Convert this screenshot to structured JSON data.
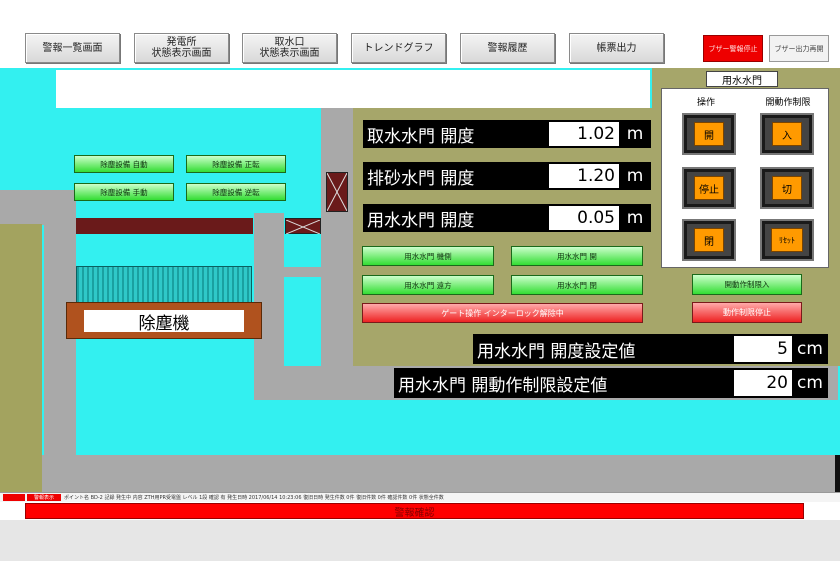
{
  "nav": [
    {
      "label": "警報一覧画面"
    },
    {
      "label": "発電所\n状態表示画面"
    },
    {
      "label": "取水口\n状態表示画面"
    },
    {
      "label": "トレンドグラフ"
    },
    {
      "label": "警報履歴"
    },
    {
      "label": "帳票出力"
    }
  ],
  "small_buttons": {
    "red": "ブザー警報停止",
    "gray": "ブザー出力再開"
  },
  "dust_remover": {
    "buttons": [
      "除塵設備 自動",
      "除塵設備 正転",
      "除塵設備 手動",
      "除塵設備 逆転"
    ],
    "label": "除塵機"
  },
  "gate_readings": [
    {
      "label": "取水水門 開度",
      "value": "1.02",
      "unit": "m"
    },
    {
      "label": "排砂水門 開度",
      "value": "1.20",
      "unit": "m"
    },
    {
      "label": "用水水門 開度",
      "value": "0.05",
      "unit": "m"
    }
  ],
  "gate_buttons": {
    "grid": [
      "用水水門 機側",
      "用水水門 開",
      "用水水門 遠方",
      "用水水門 閉"
    ],
    "interlock": "ゲート操作 インターロック解除中",
    "limit_on": "開動作制限入",
    "limit_stop": "動作制限停止"
  },
  "control_panel": {
    "title": "用水水門",
    "col1_header": "操作",
    "col2_header": "開動作制限",
    "op_buttons": [
      "開",
      "停止",
      "閉"
    ],
    "limit_buttons": [
      "入",
      "切",
      "ﾘｾｯﾄ"
    ]
  },
  "setpoints": [
    {
      "label": "用水水門 開度設定値",
      "value": "5",
      "unit": "cm"
    },
    {
      "label": "用水水門 開動作制限設定値",
      "value": "20",
      "unit": "cm"
    }
  ],
  "status_bar": {
    "indicator": "警報表示",
    "text": "ポイント名 BD-2  記録 発生中  内容 ZTH用PR受電盤  レベル 1段  確認 有  発生日時 2017/06/14 10:23:06  復旧日時  発生件数 0件  復旧件数 0件  確認件数 0件  状態全件数",
    "alarm_confirm": "警報確認"
  },
  "colors": {
    "water": "#33f0f0",
    "concrete": "#a9a9a9",
    "olive": "#a3a35f",
    "bridge": "#6a1a1a",
    "alarm_red": "#ff0000"
  }
}
